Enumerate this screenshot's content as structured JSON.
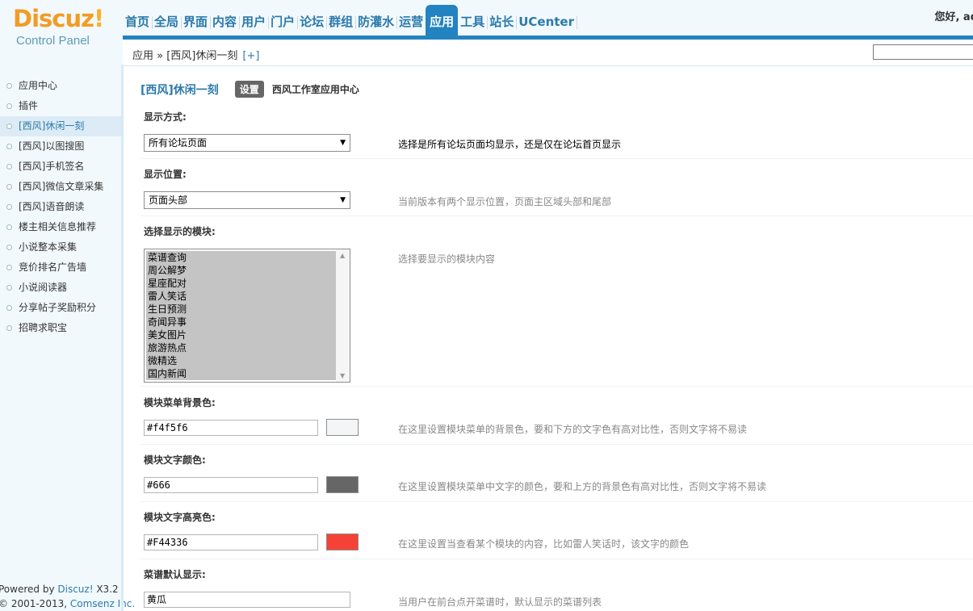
{
  "header": {
    "logo_brand": "Discuz",
    "logo_excl": "!",
    "logo_sub": "Control Panel",
    "greeting": "您好, ad"
  },
  "topnav": [
    "首页",
    "全局",
    "界面",
    "内容",
    "用户",
    "门户",
    "论坛",
    "群组",
    "防灌水",
    "运营",
    "应用",
    "工具",
    "站长",
    "UCenter"
  ],
  "topnav_active_index": 10,
  "breadcrumb": {
    "path": "应用 » [西风]休闲一刻",
    "plus": "[+]"
  },
  "sidebar": {
    "items": [
      "应用中心",
      "插件",
      "[西风]休闲一刻",
      "[西风]以图搜图",
      "[西风]手机签名",
      "[西风]微信文章采集",
      "[西风]语音朗读",
      "楼主相关信息推荐",
      "小说整本采集",
      "竞价排名广告墙",
      "小说阅读器",
      "分享帖子奖励积分",
      "招聘求职宝"
    ],
    "active_index": 2,
    "powered_prefix": "Powered by ",
    "powered_link": "Discuz!",
    "powered_version": " X3.2",
    "copyright_prefix": "© 2001-2013, ",
    "copyright_link": "Comsenz Inc."
  },
  "plugin": {
    "name": "[西风]休闲一刻",
    "tab_label": "设置",
    "center_label": "西风工作室应用中心"
  },
  "settings": {
    "display_mode": {
      "label": "显示方式:",
      "value": "所有论坛页面",
      "desc": "选择是所有论坛页面均显示，还是仅在论坛首页显示"
    },
    "display_position": {
      "label": "显示位置:",
      "value": "页面头部",
      "desc": "当前版本有两个显示位置，页面主区域头部和尾部"
    },
    "modules": {
      "label": "选择显示的模块:",
      "options": [
        "菜谱查询",
        "周公解梦",
        "星座配对",
        "雷人笑话",
        "生日预测",
        "奇闻异事",
        "美女图片",
        "旅游热点",
        "微精选",
        "国内新闻"
      ],
      "desc": "选择要显示的模块内容"
    },
    "menu_bg_color": {
      "label": "模块菜单背景色:",
      "value": "#f4f5f6",
      "swatch": "#f4f5f6",
      "desc": "在这里设置模块菜单的背景色，要和下方的文字色有高对比性，否则文字将不易读"
    },
    "text_color": {
      "label": "模块文字颜色:",
      "value": "#666",
      "swatch": "#666666",
      "desc": "在这里设置模块菜单中文字的颜色，要和上方的背景色有高对比性，否则文字将不易读"
    },
    "highlight_color": {
      "label": "模块文字高亮色:",
      "value": "#F44336",
      "swatch": "#F44336",
      "desc": "在这里设置当查看某个模块的内容，比如雷人笑话时，该文字的颜色"
    },
    "recipe_default": {
      "label": "菜谱默认显示:",
      "value": "黄瓜",
      "desc": "当用户在前台点开菜谱时，默认显示的菜谱列表"
    }
  },
  "colors": {
    "accent": "#2383c1",
    "link": "#2b7aab",
    "logo_orange": "#f29c26"
  }
}
